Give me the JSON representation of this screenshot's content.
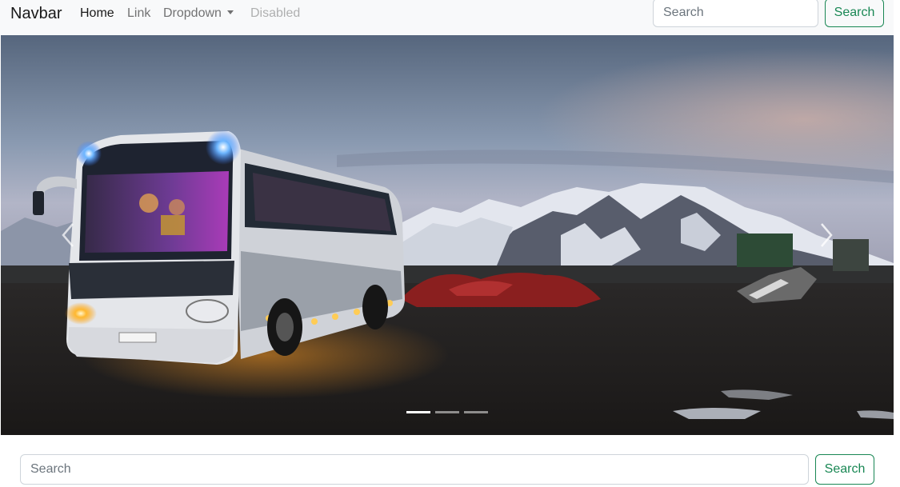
{
  "navbar": {
    "brand": "Navbar",
    "links": [
      {
        "label": "Home",
        "state": "active"
      },
      {
        "label": "Link",
        "state": "normal"
      },
      {
        "label": "Dropdown",
        "state": "dropdown"
      },
      {
        "label": "Disabled",
        "state": "disabled"
      }
    ],
    "search": {
      "placeholder": "Search",
      "value": "",
      "button_label": "Search"
    }
  },
  "carousel": {
    "image_alt": "Tour bus at dusk with snowy mountains",
    "slide_count": 3,
    "active_slide": 1,
    "prev_icon": "chevron-left-icon",
    "next_icon": "chevron-right-icon"
  },
  "bottom_search": {
    "placeholder": "Search",
    "value": "",
    "button_label": "Search"
  },
  "colors": {
    "navbar_bg": "#f8f9fa",
    "accent_success": "#198754",
    "input_border": "#ced4da",
    "placeholder": "#6c757d"
  }
}
